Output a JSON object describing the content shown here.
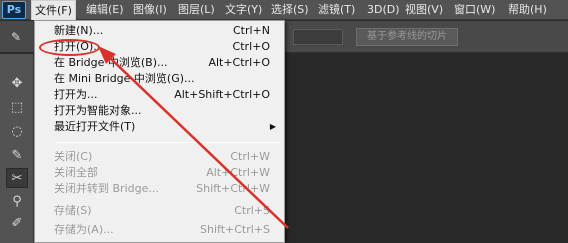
{
  "app": {
    "logo": "Ps"
  },
  "menubar": {
    "items": [
      {
        "label": "文件(F)"
      },
      {
        "label": "编辑(E)"
      },
      {
        "label": "图像(I)"
      },
      {
        "label": "图层(L)"
      },
      {
        "label": "文字(Y)"
      },
      {
        "label": "选择(S)"
      },
      {
        "label": "滤镜(T)"
      },
      {
        "label": "3D(D)"
      },
      {
        "label": "视图(V)"
      },
      {
        "label": "窗口(W)"
      },
      {
        "label": "帮助(H)"
      }
    ]
  },
  "options": {
    "slice_button": "基于参考线的切片"
  },
  "file_menu": {
    "items": [
      {
        "label": "新建(N)...",
        "shortcut": "Ctrl+N",
        "enabled": true
      },
      {
        "label": "打开(O)...",
        "shortcut": "Ctrl+O",
        "enabled": true
      },
      {
        "label": "在 Bridge 中浏览(B)...",
        "shortcut": "Alt+Ctrl+O",
        "enabled": true
      },
      {
        "label": "在 Mini Bridge 中浏览(G)...",
        "shortcut": "",
        "enabled": true
      },
      {
        "label": "打开为...",
        "shortcut": "Alt+Shift+Ctrl+O",
        "enabled": true
      },
      {
        "label": "打开为智能对象...",
        "shortcut": "",
        "enabled": true
      },
      {
        "label": "最近打开文件(T)",
        "shortcut": "",
        "enabled": true,
        "submenu": "▶"
      },
      {
        "label": "关闭(C)",
        "shortcut": "Ctrl+W",
        "enabled": false
      },
      {
        "label": "关闭全部",
        "shortcut": "Alt+Ctrl+W",
        "enabled": false
      },
      {
        "label": "关闭并转到 Bridge...",
        "shortcut": "Shift+Ctrl+W",
        "enabled": false
      },
      {
        "label": "存储(S)",
        "shortcut": "Ctrl+S",
        "enabled": false
      },
      {
        "label": "存储为(A)...",
        "shortcut": "Shift+Ctrl+S",
        "enabled": false
      }
    ]
  },
  "tools": [
    {
      "icon": "move-icon",
      "glyph": "✥"
    },
    {
      "icon": "marquee-icon",
      "glyph": "⬚"
    },
    {
      "icon": "lasso-icon",
      "glyph": "◌"
    },
    {
      "icon": "quick-select-icon",
      "glyph": "✎"
    },
    {
      "icon": "slice-icon",
      "glyph": "✂"
    },
    {
      "icon": "eyedropper-icon",
      "glyph": "⚲"
    },
    {
      "icon": "brush-icon",
      "glyph": "✐"
    },
    {
      "icon": "stamp-icon",
      "glyph": "▲"
    }
  ],
  "colors": {
    "annotation": "#d9322b",
    "menu_bg": "#f0f0f0",
    "chrome": "#535353"
  }
}
